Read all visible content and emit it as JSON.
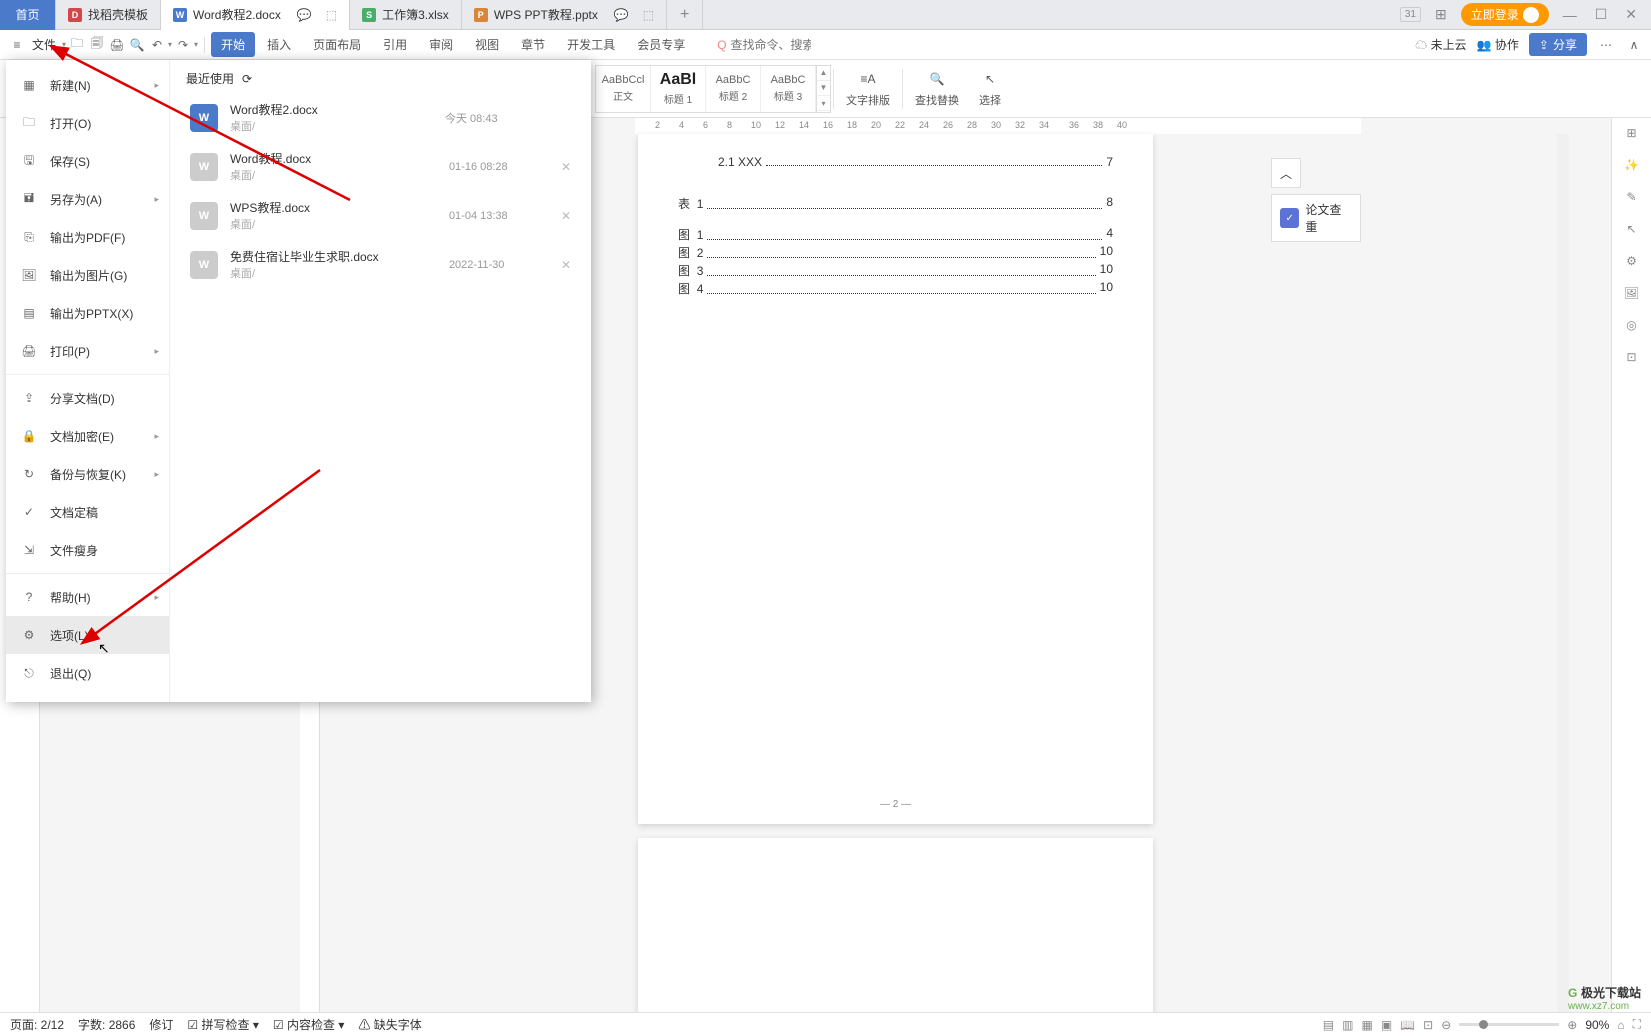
{
  "tabs": {
    "home": "首页",
    "template": "找稻壳模板",
    "word": "Word教程2.docx",
    "xls": "工作簿3.xlsx",
    "ppt": "WPS PPT教程.pptx"
  },
  "window": {
    "login": "立即登录",
    "grid_num": "31"
  },
  "toolbar": {
    "file": "文件",
    "ribbon_tabs": [
      "开始",
      "插入",
      "页面布局",
      "引用",
      "审阅",
      "视图",
      "章节",
      "开发工具",
      "会员专享"
    ],
    "search_placeholder": "查找命令、搜索模板",
    "search_prefix": "Q",
    "cloud": "未上云",
    "collab": "协作",
    "share": "分享"
  },
  "ribbon": {
    "styles": [
      {
        "preview": "AaBbCcl",
        "name": "正文"
      },
      {
        "preview": "AaBl",
        "name": "标题 1"
      },
      {
        "preview": "AaBbC",
        "name": "标题 2"
      },
      {
        "preview": "AaBbC",
        "name": "标题 3"
      }
    ],
    "layout": "文字排版",
    "findreplace": "查找替换",
    "select": "选择"
  },
  "ruler": [
    2,
    4,
    6,
    8,
    10,
    12,
    14,
    16,
    18,
    20,
    22,
    24,
    26,
    28,
    30,
    32,
    34,
    36,
    38,
    40
  ],
  "doc": {
    "line0": {
      "label": "2.1 XXX",
      "page": "7"
    },
    "table_label": "表",
    "fig_label": "图",
    "table": [
      {
        "n": "1",
        "p": "8"
      }
    ],
    "figs": [
      {
        "n": "1",
        "p": "4"
      },
      {
        "n": "2",
        "p": "10"
      },
      {
        "n": "3",
        "p": "10"
      },
      {
        "n": "4",
        "p": "10"
      }
    ],
    "page_num": "— 2 —"
  },
  "side": {
    "check": "论文查重",
    "caret": "︿"
  },
  "file_menu": {
    "recent_label": "最近使用",
    "items": [
      {
        "label": "新建(N)",
        "arrow": true
      },
      {
        "label": "打开(O)"
      },
      {
        "label": "保存(S)"
      },
      {
        "label": "另存为(A)",
        "arrow": true
      },
      {
        "label": "输出为PDF(F)"
      },
      {
        "label": "输出为图片(G)"
      },
      {
        "label": "输出为PPTX(X)"
      },
      {
        "label": "打印(P)",
        "arrow": true
      },
      {
        "label": "分享文档(D)"
      },
      {
        "label": "文档加密(E)",
        "arrow": true
      },
      {
        "label": "备份与恢复(K)",
        "arrow": true
      },
      {
        "label": "文档定稿"
      },
      {
        "label": "文件瘦身"
      },
      {
        "label": "帮助(H)",
        "arrow": true
      },
      {
        "label": "选项(L)"
      },
      {
        "label": "退出(Q)"
      }
    ],
    "recent": [
      {
        "name": "Word教程2.docx",
        "path": "桌面/",
        "time": "今天 08:43"
      },
      {
        "name": "Word教程.docx",
        "path": "桌面/",
        "time": "01-16 08:28"
      },
      {
        "name": "WPS教程.docx",
        "path": "桌面/",
        "time": "01-04 13:38"
      },
      {
        "name": "免费住宿让毕业生求职.docx",
        "path": "桌面/",
        "time": "2022-11-30"
      }
    ]
  },
  "status": {
    "page": "页面: 2/12",
    "words": "字数: 2866",
    "track": "修订",
    "spell": "拼写检查",
    "content": "内容检查",
    "font": "缺失字体",
    "zoom": "90%"
  },
  "watermark": {
    "t1": "极光下载站",
    "t2": "www.xz7.com"
  }
}
